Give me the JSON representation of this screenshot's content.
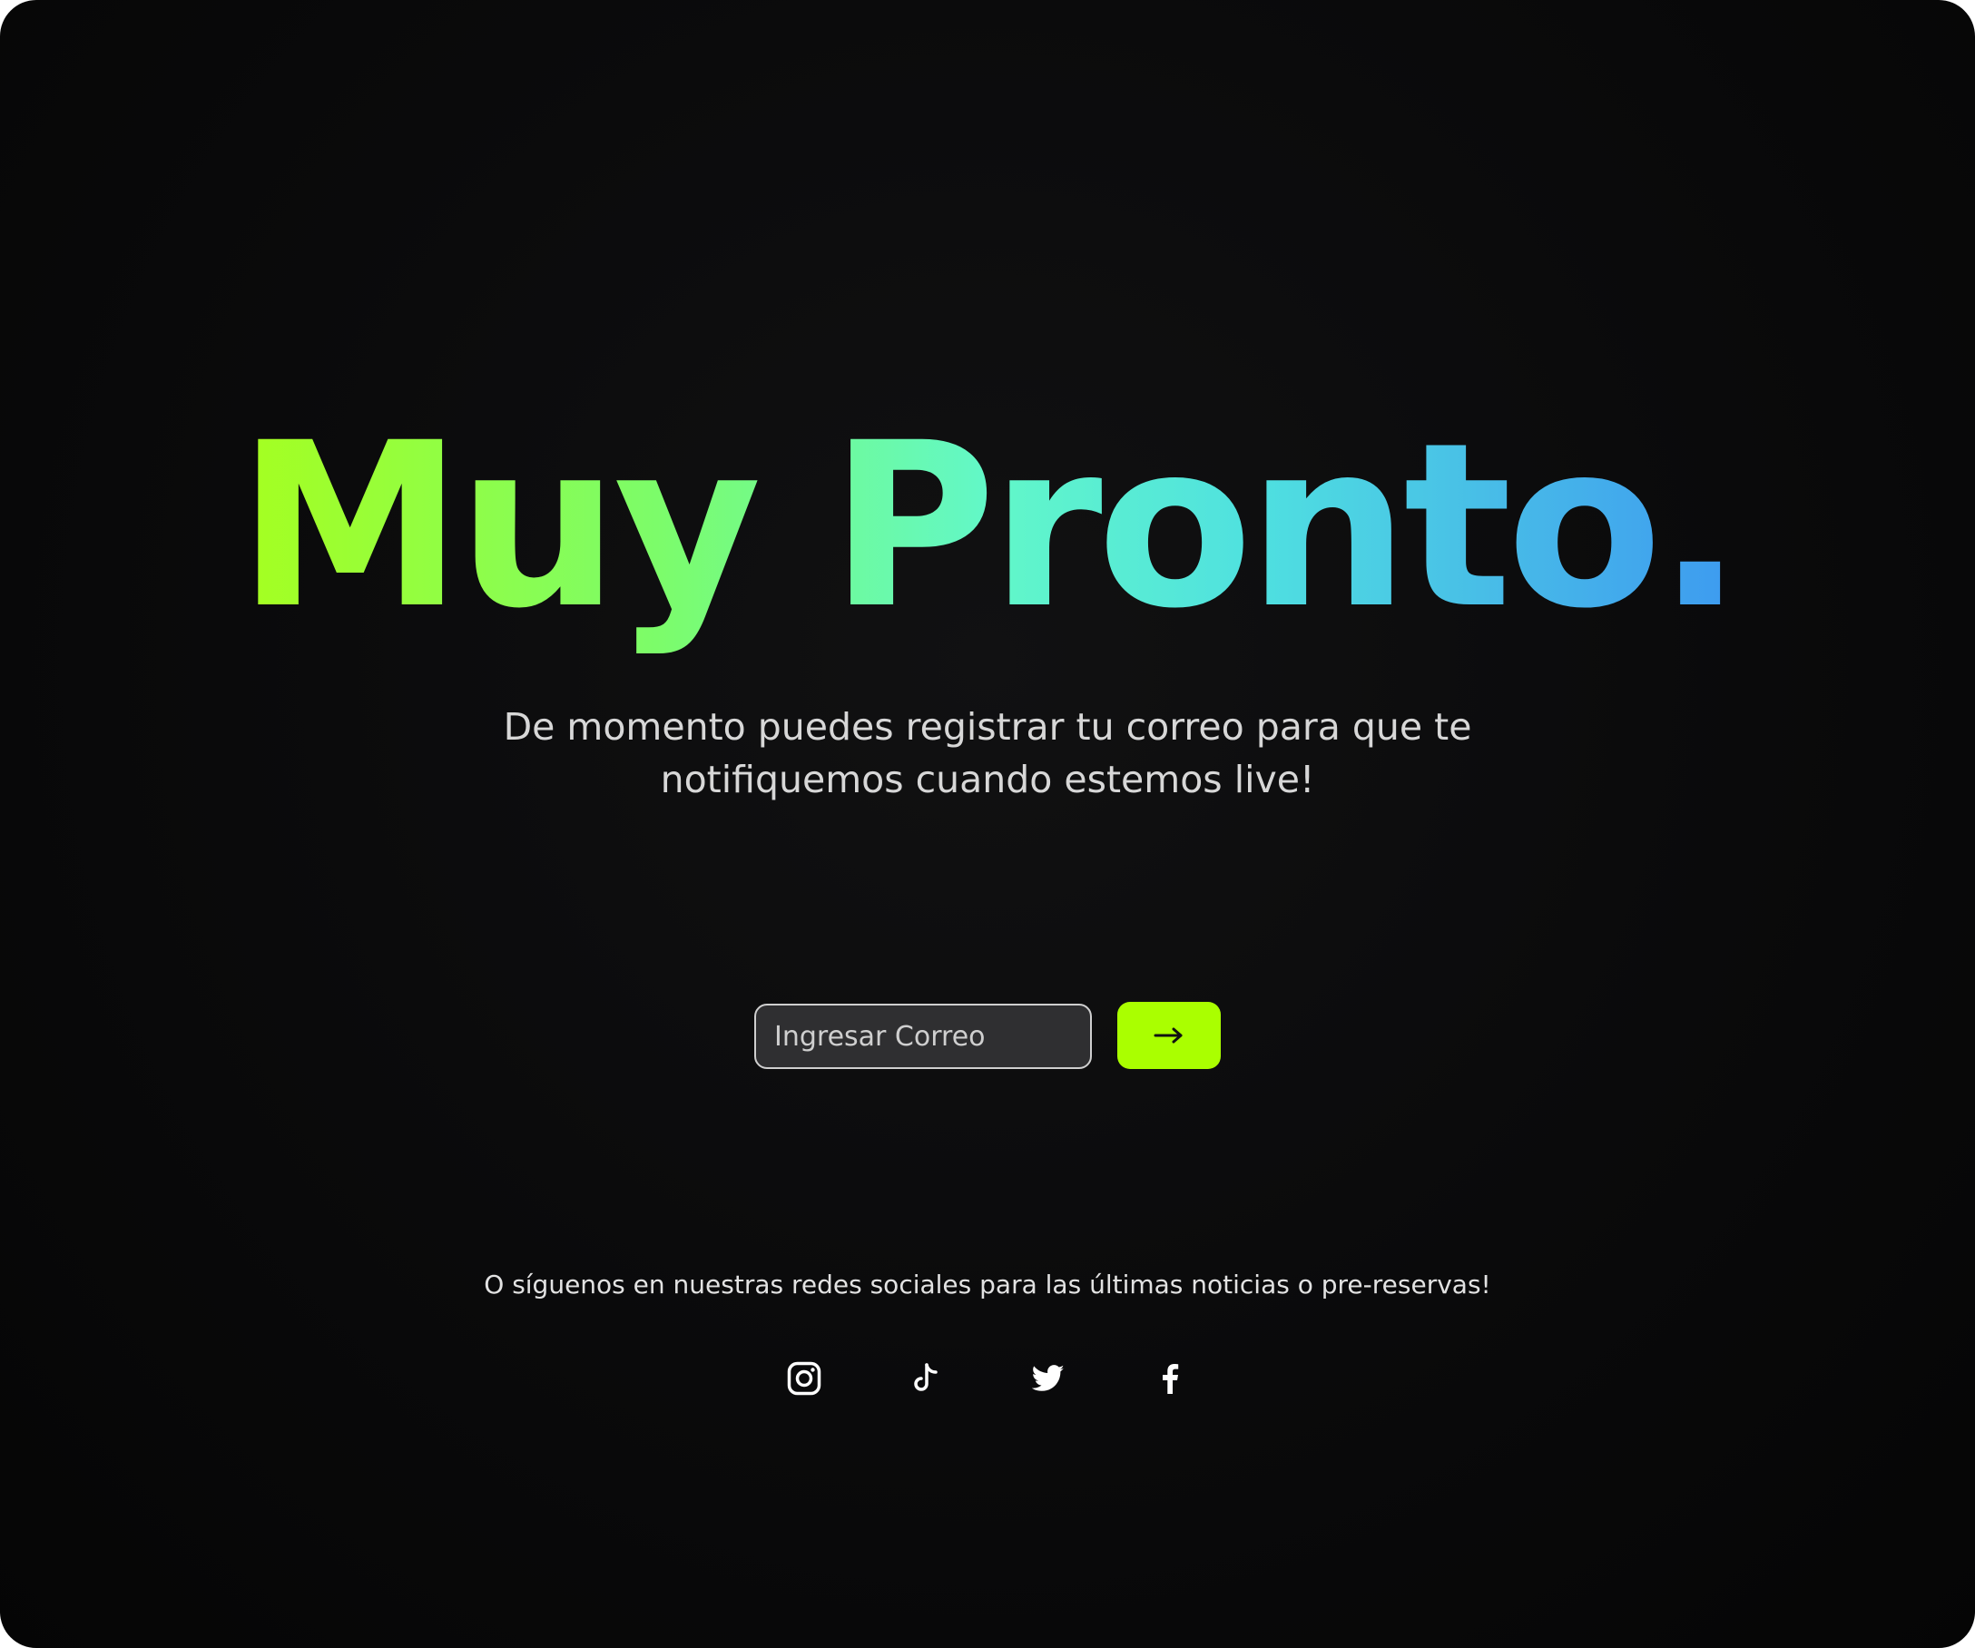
{
  "headline": "Muy Pronto.",
  "subtitle": "De momento puedes registrar tu correo para que te notifiquemos cuando estemos live!",
  "signup": {
    "email_placeholder": "Ingresar Correo",
    "email_value": "",
    "submit_icon": "arrow-right-icon"
  },
  "social": {
    "text": "O síguenos en nuestras redes sociales para las últimas noticias o pre-reservas!",
    "icons": [
      "instagram-icon",
      "tiktok-icon",
      "twitter-icon",
      "facebook-icon"
    ]
  },
  "colors": {
    "background": "#0a0a0b",
    "accent": "#aaff00",
    "gradient": [
      "#a6ff1f",
      "#62f8c8",
      "#3d9af0"
    ]
  }
}
